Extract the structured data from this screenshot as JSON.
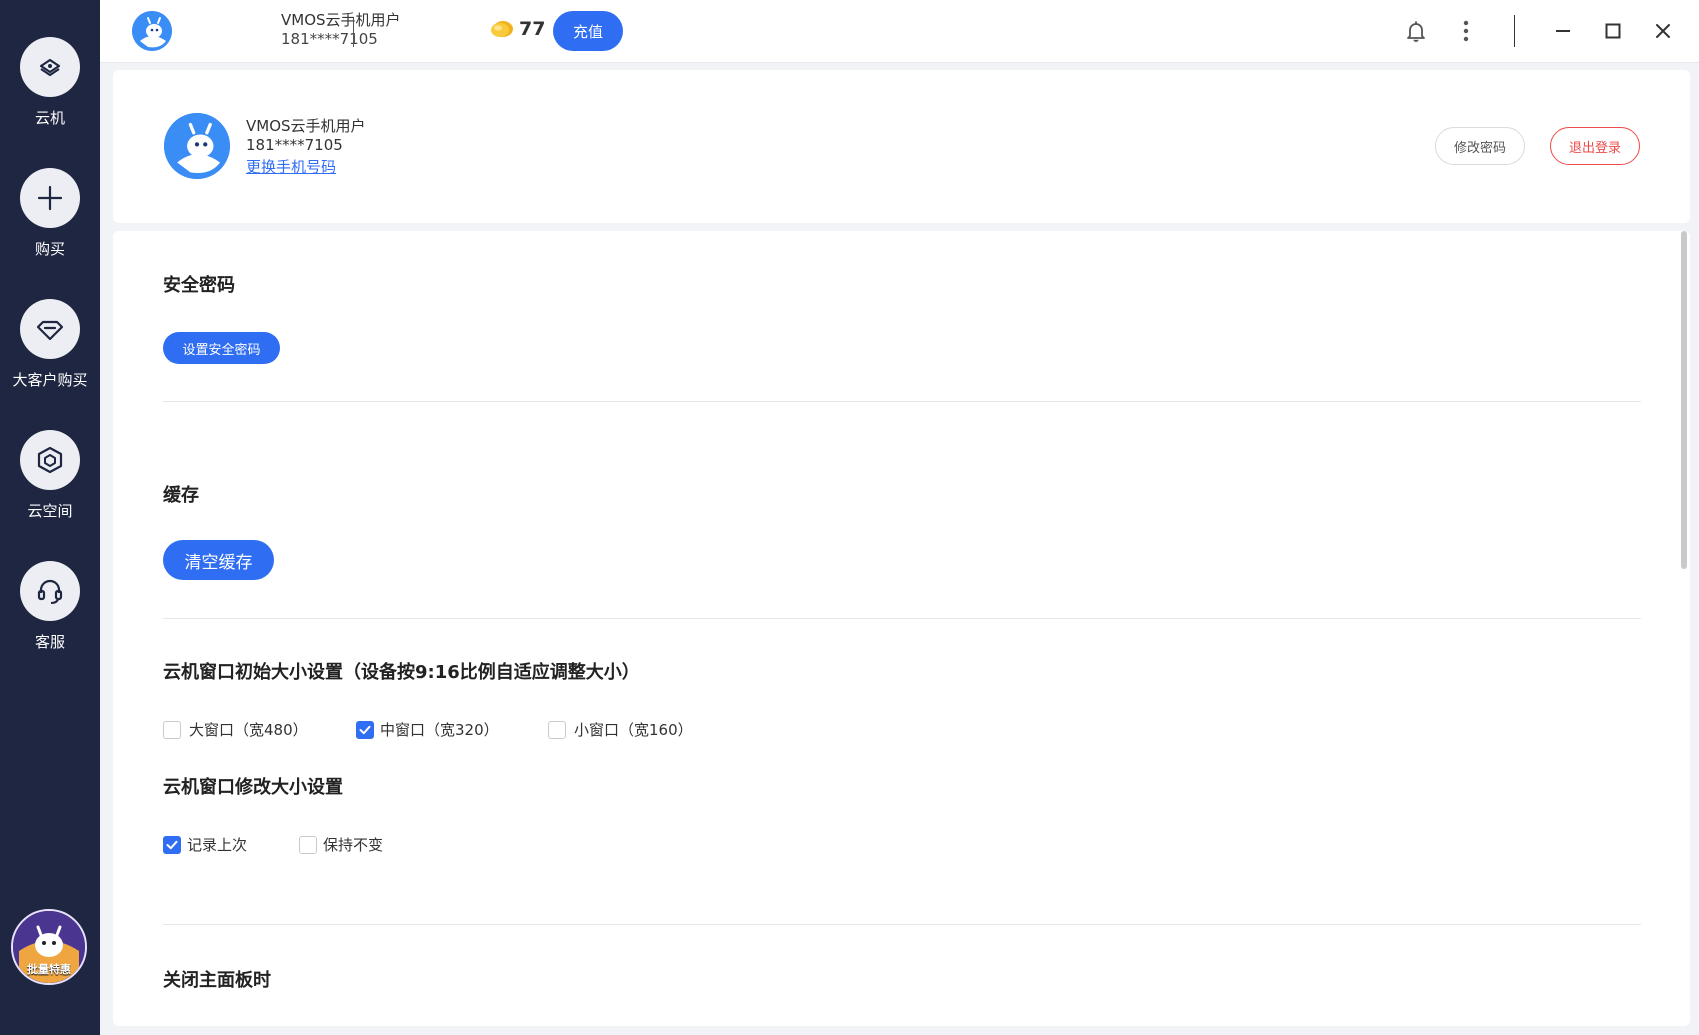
{
  "sidebar": {
    "items": [
      {
        "label": "云机",
        "icon": "cloud-phone-icon"
      },
      {
        "label": "购买",
        "icon": "plus-icon"
      },
      {
        "label": "大客户购买",
        "icon": "diamond-icon"
      },
      {
        "label": "云空间",
        "icon": "cube-icon"
      },
      {
        "label": "客服",
        "icon": "headset-icon"
      }
    ],
    "batch_badge": "批量特惠"
  },
  "topbar": {
    "username": "VMOS云手机用户",
    "phone": "181****7105",
    "coin_count": "77",
    "recharge_label": "充值"
  },
  "profile": {
    "username": "VMOS云手机用户",
    "phone": "181****7105",
    "change_phone_link": "更换手机号码",
    "change_password_label": "修改密码",
    "logout_label": "退出登录"
  },
  "settings": {
    "security": {
      "title": "安全密码",
      "button": "设置安全密码"
    },
    "cache": {
      "title": "缓存",
      "button": "清空缓存"
    },
    "initial_size": {
      "title": "云机窗口初始大小设置（设备按9:16比例自适应调整大小）",
      "options": [
        {
          "label": "大窗口（宽480）",
          "checked": false
        },
        {
          "label": "中窗口（宽320）",
          "checked": true
        },
        {
          "label": "小窗口（宽160）",
          "checked": false
        }
      ]
    },
    "resize": {
      "title": "云机窗口修改大小设置",
      "options": [
        {
          "label": "记录上次",
          "checked": true
        },
        {
          "label": "保持不变",
          "checked": false
        }
      ]
    },
    "close_panel": {
      "title": "关闭主面板时"
    }
  },
  "colors": {
    "accent": "#2f6df2",
    "sidebar_bg": "#1f2641",
    "danger": "#ee4b4b"
  }
}
